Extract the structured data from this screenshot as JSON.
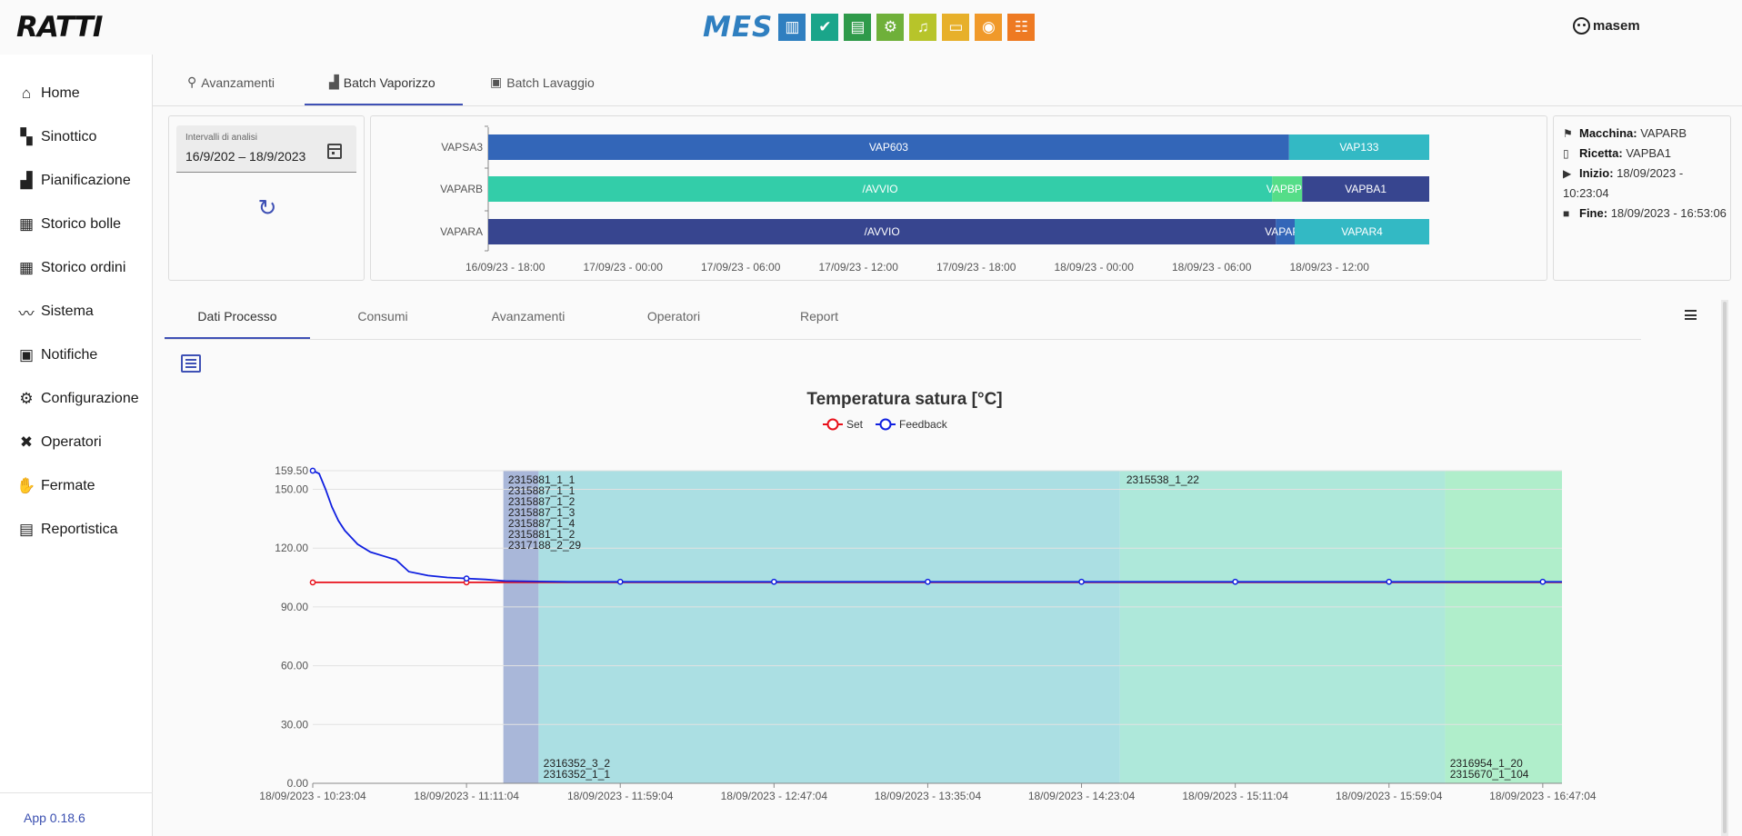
{
  "header": {
    "logo": "RATTI",
    "mes_label": "MES",
    "mes_icons": [
      {
        "name": "bars-chart-icon",
        "glyph": "▥",
        "color": "#2f7fc0"
      },
      {
        "name": "check-circle-icon",
        "glyph": "✔",
        "color": "#1aa58a"
      },
      {
        "name": "document-icon",
        "glyph": "▤",
        "color": "#2f9a4a"
      },
      {
        "name": "gears-icon",
        "glyph": "⚙",
        "color": "#6fb03a"
      },
      {
        "name": "bell-icon",
        "glyph": "♫",
        "color": "#b7c42a"
      },
      {
        "name": "tablet-icon",
        "glyph": "▭",
        "color": "#e7b02a"
      },
      {
        "name": "eye-icon",
        "glyph": "◉",
        "color": "#f0992a"
      },
      {
        "name": "hierarchy-icon",
        "glyph": "☷",
        "color": "#ee7a22"
      }
    ],
    "user": "masem"
  },
  "sidebar": {
    "items": [
      {
        "label": "Home",
        "icon": "home-icon",
        "glyph": "⌂"
      },
      {
        "label": "Sinottico",
        "icon": "map-icon",
        "glyph": "▚"
      },
      {
        "label": "Pianificazione",
        "icon": "factory-icon",
        "glyph": "▟"
      },
      {
        "label": "Storico bolle",
        "icon": "chart-icon",
        "glyph": "▦"
      },
      {
        "label": "Storico ordini",
        "icon": "chart-icon",
        "glyph": "▦"
      },
      {
        "label": "Sistema",
        "icon": "pulse-icon",
        "glyph": "〰"
      },
      {
        "label": "Notifiche",
        "icon": "notification-icon",
        "glyph": "▣"
      },
      {
        "label": "Configurazione",
        "icon": "gear-icon",
        "glyph": "⚙"
      },
      {
        "label": "Operatori",
        "icon": "tools-icon",
        "glyph": "✖"
      },
      {
        "label": "Fermate",
        "icon": "hand-icon",
        "glyph": "✋"
      },
      {
        "label": "Reportistica",
        "icon": "report-icon",
        "glyph": "▤"
      }
    ],
    "version": "App 0.18.6"
  },
  "top_tabs": [
    {
      "label": "Avanzamenti",
      "icon": "search-icon",
      "glyph": "⚲"
    },
    {
      "label": "Batch Vaporizzo",
      "icon": "factory-icon",
      "glyph": "▟"
    },
    {
      "label": "Batch Lavaggio",
      "icon": "washer-icon",
      "glyph": "▣"
    }
  ],
  "date_filter": {
    "label": "Intervalli di analisi",
    "value": "16/9/202 – 18/9/2023"
  },
  "gantt": {
    "rows": [
      "VAPSA3",
      "VAPARB",
      "VAPARA"
    ],
    "x_ticks": [
      "16/09/23 - 18:00",
      "17/09/23 - 00:00",
      "17/09/23 - 06:00",
      "17/09/23 - 12:00",
      "17/09/23 - 18:00",
      "18/09/23 - 00:00",
      "18/09/23 - 06:00",
      "18/09/23 - 12:00"
    ],
    "bars": [
      {
        "row": 0,
        "start": 0.0,
        "end": 0.851,
        "label": "VAP603",
        "color": "#3366b8"
      },
      {
        "row": 0,
        "start": 0.851,
        "end": 1.0,
        "label": "VAP133",
        "color": "#33b9c4"
      },
      {
        "row": 1,
        "start": 0.0,
        "end": 0.833,
        "label": "/AVVIO",
        "color": "#33cda9"
      },
      {
        "row": 1,
        "start": 0.833,
        "end": 0.865,
        "label": "VAPBPL",
        "color": "#55dd88"
      },
      {
        "row": 1,
        "start": 0.865,
        "end": 1.0,
        "label": "VAPBA1",
        "color": "#37458f"
      },
      {
        "row": 2,
        "start": 0.0,
        "end": 0.837,
        "label": "/AVVIO",
        "color": "#37458f"
      },
      {
        "row": 2,
        "start": 0.837,
        "end": 0.857,
        "label": "VAPAPL",
        "color": "#3366b8"
      },
      {
        "row": 2,
        "start": 0.857,
        "end": 1.0,
        "label": "VAPAR4",
        "color": "#33b9c4"
      }
    ]
  },
  "machine_info": {
    "macchina_label": "Macchina:",
    "macchina": "VAPARB",
    "ricetta_label": "Ricetta:",
    "ricetta": "VAPBA1",
    "inizio_label": "Inizio:",
    "inizio": "18/09/2023 - 10:23:04",
    "fine_label": "Fine:",
    "fine": "18/09/2023 - 16:53:06"
  },
  "process_tabs": [
    "Dati Processo",
    "Consumi",
    "Avanzamenti",
    "Operatori",
    "Report"
  ],
  "chart_data": {
    "type": "line",
    "title": "Temperatura satura [°C]",
    "legend": [
      "Set",
      "Feedback"
    ],
    "legend_placement": "top",
    "ylim": [
      0,
      159.5
    ],
    "y_ticks": [
      "0.00",
      "30.00",
      "60.00",
      "90.00",
      "120.00",
      "150.00",
      "159.50"
    ],
    "x_ticks": [
      "18/09/2023 - 10:23:04",
      "18/09/2023 - 11:11:04",
      "18/09/2023 - 11:59:04",
      "18/09/2023 - 12:47:04",
      "18/09/2023 - 13:35:04",
      "18/09/2023 - 14:23:04",
      "18/09/2023 - 15:11:04",
      "18/09/2023 - 15:59:04",
      "18/09/2023 - 16:47:04"
    ],
    "x_minutes_range": [
      0,
      390
    ],
    "series": [
      {
        "name": "Set",
        "color": "#e8101a",
        "x": [
          0,
          48,
          96,
          144,
          192,
          240,
          288,
          336,
          384,
          390
        ],
        "y": [
          102.5,
          102.5,
          102.5,
          102.5,
          102.5,
          102.5,
          102.5,
          102.5,
          102.5,
          102.5
        ],
        "markers_x": [
          0,
          48
        ]
      },
      {
        "name": "Feedback",
        "color": "#1020e0",
        "x": [
          0,
          2,
          4,
          6,
          8,
          10,
          14,
          18,
          22,
          26,
          30,
          36,
          42,
          48,
          54,
          60,
          70,
          80,
          96,
          144,
          192,
          240,
          288,
          336,
          384,
          390
        ],
        "y": [
          159.5,
          158,
          150,
          141,
          134,
          129,
          122,
          118,
          116,
          114,
          108,
          106,
          105,
          104.5,
          104,
          103.2,
          103,
          102.8,
          102.8,
          102.8,
          102.8,
          102.8,
          102.8,
          102.8,
          102.8,
          102.8
        ],
        "markers_x": [
          0,
          48,
          96,
          144,
          192,
          240,
          288,
          336,
          384
        ]
      }
    ],
    "bands": [
      {
        "start": 59.5,
        "end": 70.5,
        "color": "#a9b7d9"
      },
      {
        "start": 70.5,
        "end": 252,
        "color": "#abdfe3"
      },
      {
        "start": 252,
        "end": 353.5,
        "color": "#aee8da"
      },
      {
        "start": 353.5,
        "end": 390,
        "color": "#b0eecb"
      }
    ],
    "annotations": [
      {
        "x": 61,
        "anchor": "top",
        "lines": [
          "2315881_1_1",
          "2315887_1_1",
          "2315887_1_2",
          "2315887_1_3",
          "2315887_1_4",
          "2315881_1_2",
          "2317188_2_29"
        ]
      },
      {
        "x": 72,
        "anchor": "bottom",
        "lines": [
          "2316352_3_2",
          "2316352_1_1"
        ]
      },
      {
        "x": 254,
        "anchor": "top",
        "lines": [
          "2315538_1_22"
        ]
      },
      {
        "x": 355,
        "anchor": "bottom",
        "lines": [
          "2316954_1_20",
          "2315670_1_104"
        ]
      }
    ]
  }
}
